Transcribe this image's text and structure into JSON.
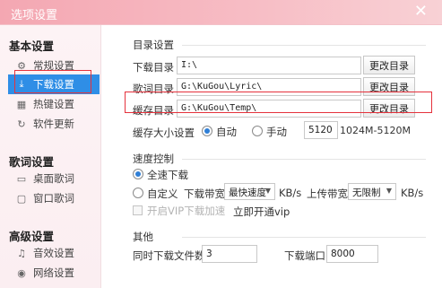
{
  "window": {
    "title": "选项设置",
    "close_glyph": "✕"
  },
  "sidebar": {
    "basic": {
      "title": "基本设置",
      "items": [
        {
          "label": "常规设置",
          "icon": "gear-icon",
          "glyph": "⚙"
        },
        {
          "label": "下载设置",
          "icon": "download-icon",
          "glyph": "⤓",
          "active": true
        },
        {
          "label": "热键设置",
          "icon": "keyboard-icon",
          "glyph": "▦"
        },
        {
          "label": "软件更新",
          "icon": "refresh-icon",
          "glyph": "↻"
        }
      ]
    },
    "lyrics": {
      "title": "歌词设置",
      "items": [
        {
          "label": "桌面歌词",
          "icon": "desktop-icon",
          "glyph": "▭"
        },
        {
          "label": "窗口歌词",
          "icon": "window-icon",
          "glyph": "▢"
        }
      ]
    },
    "advanced": {
      "title": "高级设置",
      "items": [
        {
          "label": "音效设置",
          "icon": "equalizer-icon",
          "glyph": "♫"
        },
        {
          "label": "网络设置",
          "icon": "network-icon",
          "glyph": "◉"
        }
      ]
    }
  },
  "directory": {
    "section_title": "目录设置",
    "download": {
      "label": "下载目录",
      "value": "I:\\",
      "button": "更改目录"
    },
    "lyric": {
      "label": "歌词目录",
      "value": "G:\\KuGou\\Lyric\\",
      "button": "更改目录"
    },
    "cache": {
      "label": "缓存目录",
      "value": "G:\\KuGou\\Temp\\",
      "button": "更改目录"
    },
    "cache_size": {
      "label": "缓存大小设置",
      "auto": "自动",
      "manual": "手动",
      "value": "5120",
      "range": "1024M-5120M",
      "selected": "auto"
    }
  },
  "speed": {
    "section_title": "速度控制",
    "full_speed": "全速下载",
    "custom": "自定义",
    "download_bw_label": "下载带宽",
    "download_bw_value": "最快速度",
    "unit1": "KB/s",
    "upload_bw_label": "上传带宽",
    "upload_bw_value": "无限制",
    "unit2": "KB/s",
    "vip_checkbox": "开启VIP下载加速",
    "vip_link": "立即开通vip",
    "selected": "full"
  },
  "other": {
    "section_title": "其他",
    "concurrent_label": "同时下载文件数:",
    "concurrent_value": "3",
    "port_label": "下载端口:",
    "port_value": "8000"
  },
  "colors": {
    "accent": "#2f8ee6",
    "highlight": "#e5323c",
    "titlebar": "#f4a7b2"
  }
}
